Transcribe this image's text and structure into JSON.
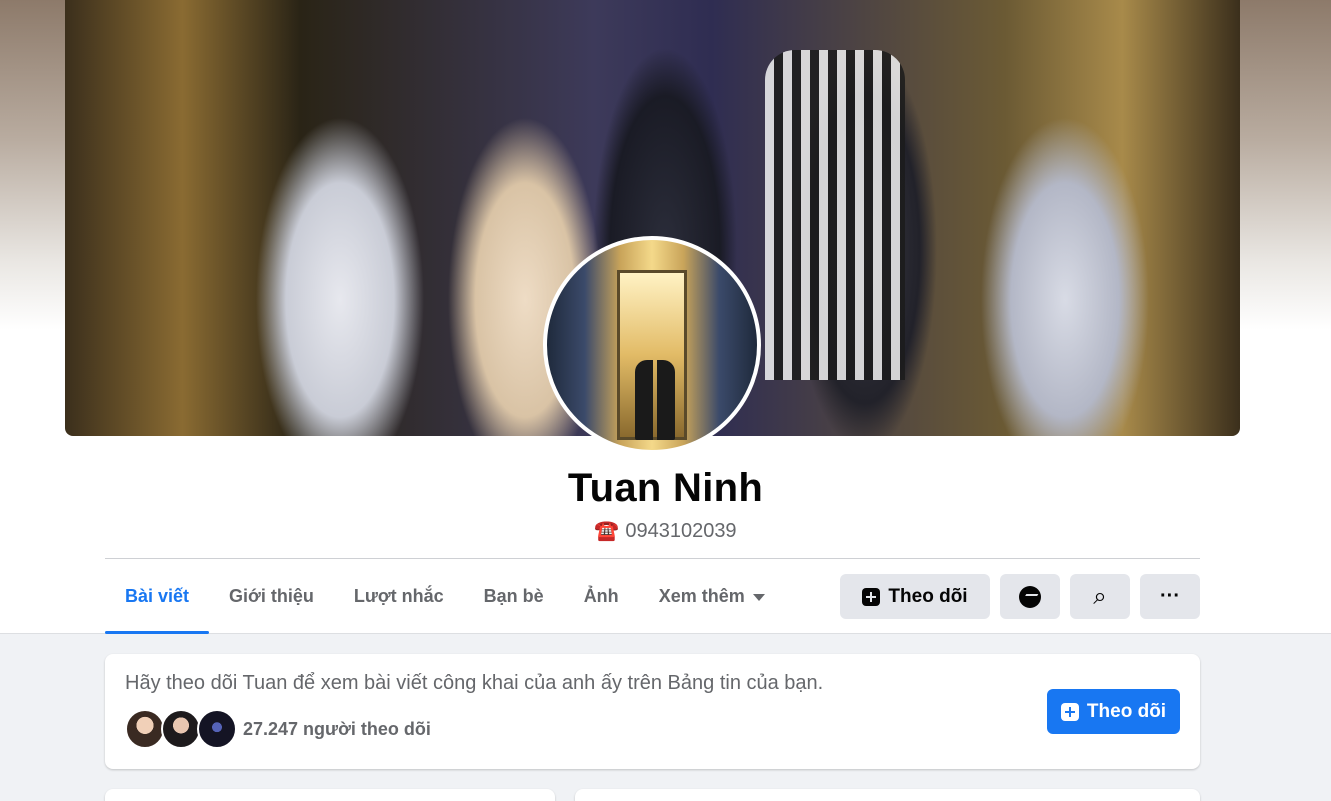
{
  "profile": {
    "name": "Tuan Ninh",
    "phone_icon": "☎️",
    "phone": "0943102039"
  },
  "tabs": [
    {
      "label": "Bài viết",
      "active": true
    },
    {
      "label": "Giới thiệu"
    },
    {
      "label": "Lượt nhắc"
    },
    {
      "label": "Bạn bè"
    },
    {
      "label": "Ảnh"
    },
    {
      "label": "Xem thêm"
    }
  ],
  "actions": {
    "follow_label": "Theo dõi",
    "messenger_icon": "messenger-icon",
    "search_icon": "search-icon",
    "more_icon": "more-icon",
    "more_glyph": "···",
    "search_glyph": "⌕"
  },
  "follow_card": {
    "text": "Hãy theo dõi Tuan để xem bài viết công khai của anh ấy trên Bảng tin của bạn.",
    "followers_count": "27.247 người theo dõi",
    "button_label": "Theo dõi"
  },
  "colors": {
    "accent": "#1877f2",
    "background": "#f0f2f5",
    "secondary_text": "#65676b"
  }
}
